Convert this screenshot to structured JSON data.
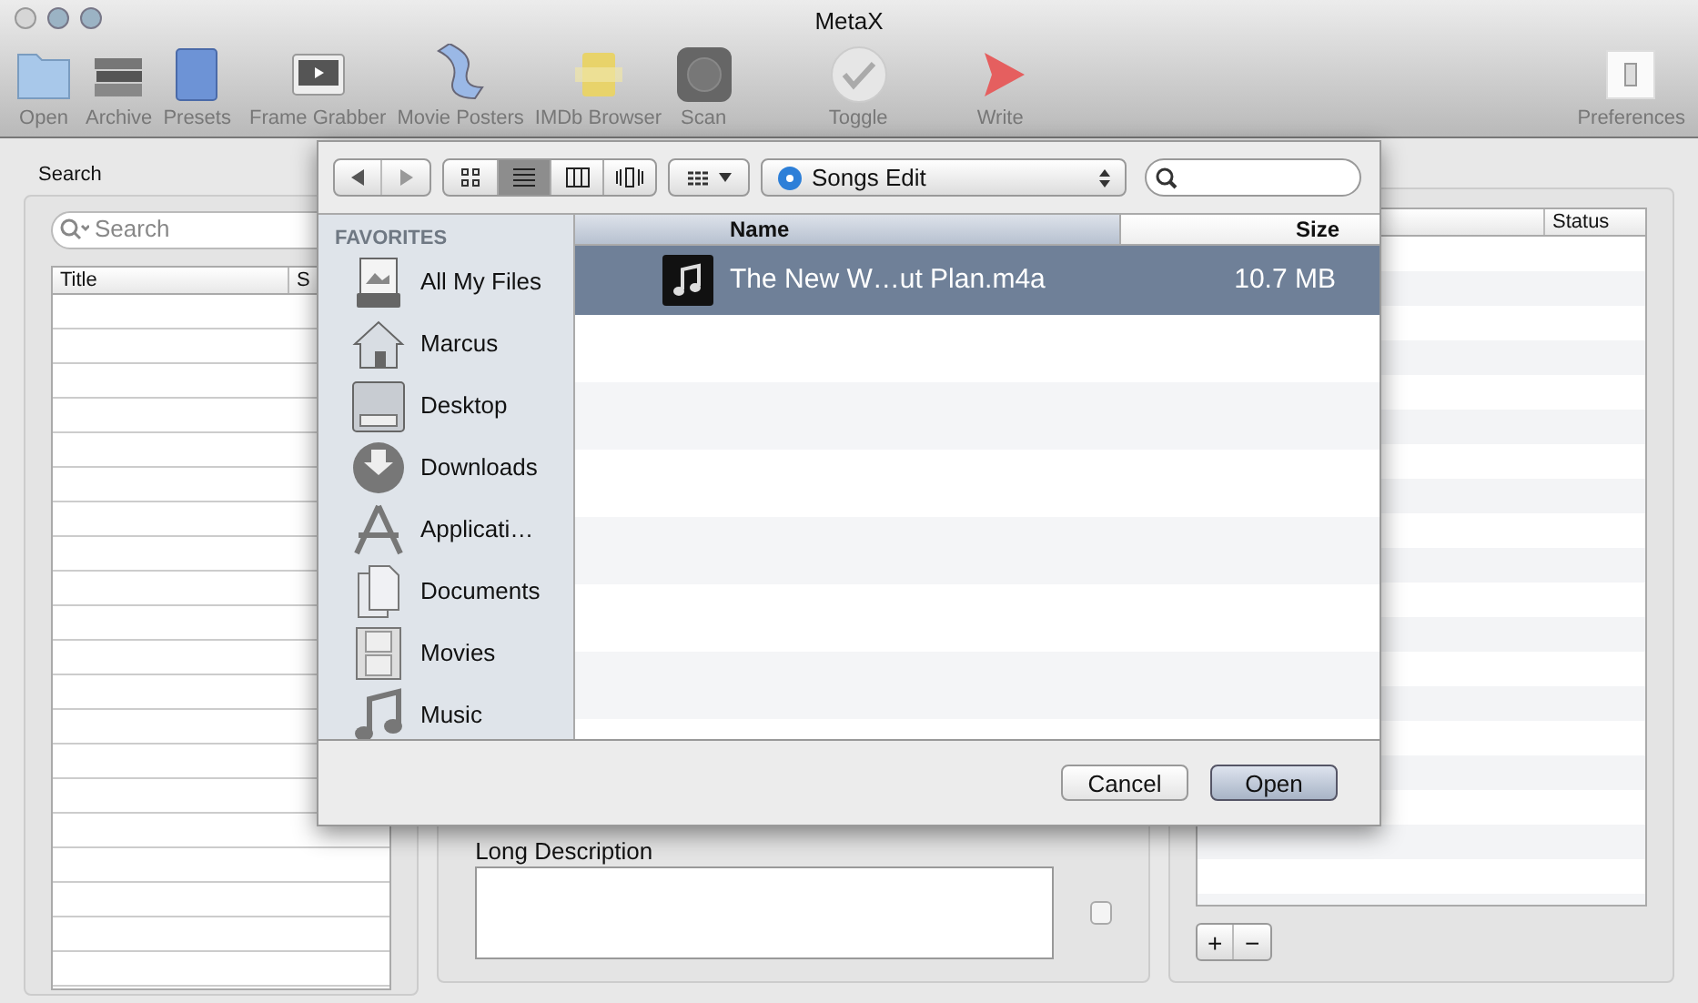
{
  "window": {
    "title": "MetaX"
  },
  "toolbar": [
    {
      "label": "Open",
      "kind": "folder"
    },
    {
      "label": "Archive",
      "kind": "books"
    },
    {
      "label": "Presets",
      "kind": "book"
    },
    {
      "label": "Frame Grabber",
      "kind": "screen"
    },
    {
      "label": "Movie Posters",
      "kind": "film"
    },
    {
      "label": "IMDb Browser",
      "kind": "badge"
    },
    {
      "label": "Scan",
      "kind": "scan"
    },
    {
      "label": "Toggle",
      "kind": "check"
    },
    {
      "label": "Write",
      "kind": "play"
    },
    {
      "label": "Preferences",
      "kind": "switch"
    }
  ],
  "search_panel": {
    "label": "Search",
    "placeholder": "Search",
    "columns": [
      "Title",
      "S"
    ]
  },
  "description": {
    "label": "Long Description",
    "checked": false
  },
  "right_table": {
    "columns": [
      "Status"
    ],
    "buttons": [
      "+",
      "−"
    ]
  },
  "dialog": {
    "view_modes": [
      {
        "kind": "icons",
        "selected": false
      },
      {
        "kind": "list",
        "selected": true
      },
      {
        "kind": "columns",
        "selected": false
      },
      {
        "kind": "coverflow",
        "selected": false
      }
    ],
    "location": "Songs Edit",
    "sidebar": {
      "heading": "FAVORITES",
      "items": [
        {
          "label": "All My Files",
          "kind": "files"
        },
        {
          "label": "Marcus",
          "kind": "home"
        },
        {
          "label": "Desktop",
          "kind": "desktop"
        },
        {
          "label": "Downloads",
          "kind": "downloads"
        },
        {
          "label": "Applicati…",
          "kind": "apps"
        },
        {
          "label": "Documents",
          "kind": "documents"
        },
        {
          "label": "Movies",
          "kind": "movies"
        },
        {
          "label": "Music",
          "kind": "music"
        }
      ]
    },
    "file_list": {
      "columns": [
        "Name",
        "Size"
      ],
      "rows": [
        {
          "name": "The New W…ut Plan.m4a",
          "size": "10.7 MB",
          "selected": true
        }
      ]
    },
    "buttons": [
      {
        "label": "Cancel",
        "kind": "cancel"
      },
      {
        "label": "Open",
        "kind": "default"
      }
    ]
  }
}
